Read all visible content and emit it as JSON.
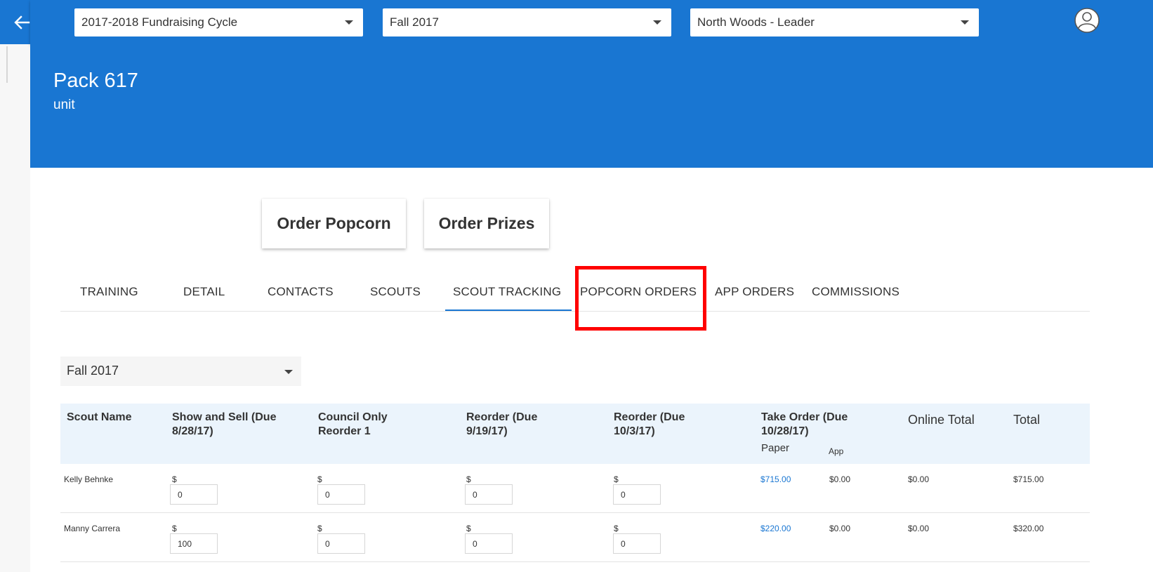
{
  "topbar": {
    "cycle_select": "2017-2018 Fundraising Cycle",
    "season_select": "Fall 2017",
    "role_select": "North Woods - Leader",
    "icons": {
      "back": "arrow-left-icon",
      "user": "user-circle-icon"
    }
  },
  "header": {
    "title": "Pack 617",
    "subtitle": "unit"
  },
  "actions": {
    "order_popcorn": "Order Popcorn",
    "order_prizes": "Order Prizes"
  },
  "tabs": [
    {
      "label": "TRAINING"
    },
    {
      "label": "DETAIL"
    },
    {
      "label": "CONTACTS"
    },
    {
      "label": "SCOUTS"
    },
    {
      "label": "SCOUT TRACKING",
      "active": true
    },
    {
      "label": "POPCORN ORDERS"
    },
    {
      "label": "APP ORDERS"
    },
    {
      "label": "COMMISSIONS"
    }
  ],
  "filter": {
    "season": "Fall 2017"
  },
  "table": {
    "headers": {
      "scout_name": "Scout Name",
      "show_and_sell": "Show and Sell (Due 8/28/17)",
      "council_only": "Council Only Reorder 1",
      "reorder_1": "Reorder (Due 9/19/17)",
      "reorder_2": "Reorder (Due 10/3/17)",
      "take_order": "Take Order (Due 10/28/17)",
      "take_order_paper": "Paper",
      "take_order_app": "App",
      "online_total": "Online Total",
      "total": "Total"
    },
    "currency_symbol": "$",
    "rows": [
      {
        "name": "Kelly Behnke",
        "show_and_sell": "0",
        "council_only": "0",
        "reorder_1": "0",
        "reorder_2": "0",
        "paper": "$715.00",
        "app": "$0.00",
        "online_total": "$0.00",
        "total": "$715.00"
      },
      {
        "name": "Manny Carrera",
        "show_and_sell": "100",
        "council_only": "0",
        "reorder_1": "0",
        "reorder_2": "0",
        "paper": "$220.00",
        "app": "$0.00",
        "online_total": "$0.00",
        "total": "$320.00"
      }
    ]
  },
  "colors": {
    "primary": "#1976d2",
    "highlight": "#ff0000",
    "header_row": "#ebf4fc"
  }
}
